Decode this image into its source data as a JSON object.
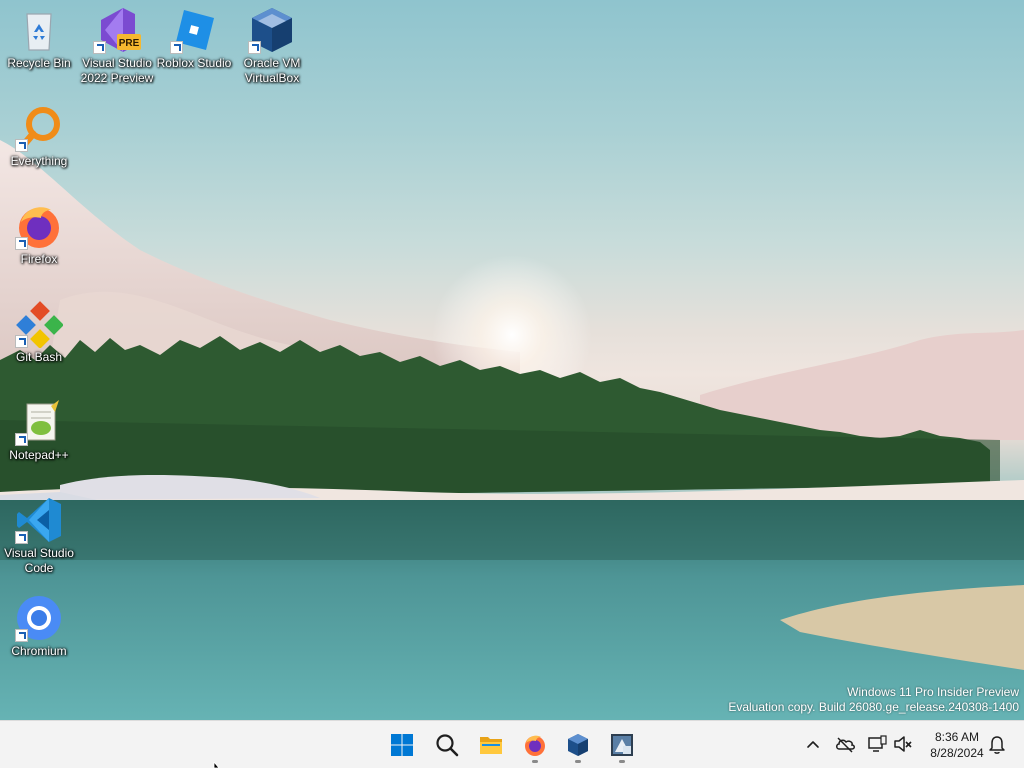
{
  "desktop": {
    "icons": [
      {
        "label": "Recycle Bin"
      },
      {
        "label": "Visual Studio 2022 Preview",
        "badge": "PRE"
      },
      {
        "label": "Roblox Studio"
      },
      {
        "label": "Oracle VM VirtualBox"
      },
      {
        "label": "Everything"
      },
      {
        "label": "Firefox"
      },
      {
        "label": "Git Bash"
      },
      {
        "label": "Notepad++"
      },
      {
        "label": "Visual Studio Code"
      },
      {
        "label": "Chromium"
      }
    ],
    "watermark": {
      "line1": "Windows 11 Pro Insider Preview",
      "line2": "Evaluation copy. Build 26080.ge_release.240308-1400"
    }
  },
  "taskbar": {
    "pinned": [
      {
        "name": "start",
        "icon": "windows-logo-icon"
      },
      {
        "name": "search",
        "icon": "search-icon"
      },
      {
        "name": "file-explorer",
        "icon": "folder-icon"
      },
      {
        "name": "firefox",
        "icon": "firefox-icon",
        "running": true
      },
      {
        "name": "virtualbox",
        "icon": "virtualbox-icon",
        "running": true
      },
      {
        "name": "app",
        "icon": "app-icon",
        "running": true
      }
    ],
    "tray": {
      "time": "8:36 AM",
      "date": "8/28/2024"
    }
  },
  "colors": {
    "taskbar_bg": "#f3f3f3",
    "accent": "#0078d4"
  }
}
